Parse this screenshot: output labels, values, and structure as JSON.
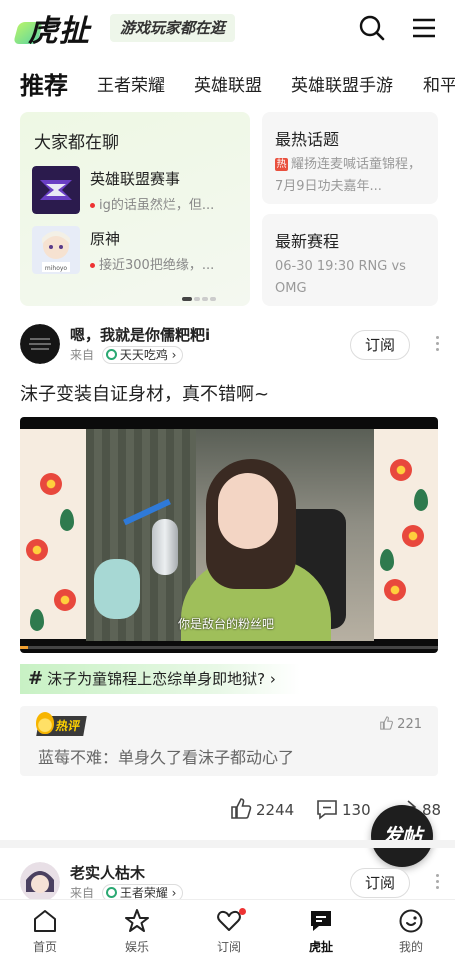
{
  "header": {
    "logo_text": "虎扯",
    "slogan": "游戏玩家都在逛",
    "search_icon": "search-icon",
    "menu_icon": "menu-icon"
  },
  "tabs": [
    {
      "label": "推荐",
      "active": true
    },
    {
      "label": "王者荣耀",
      "active": false
    },
    {
      "label": "英雄联盟",
      "active": false
    },
    {
      "label": "英雄联盟手游",
      "active": false
    },
    {
      "label": "和平",
      "active": false
    }
  ],
  "chat_card": {
    "title": "大家都在聊",
    "items": [
      {
        "name": "英雄联盟赛事",
        "snippet": "ig的话虽然烂，但..."
      },
      {
        "name": "原神",
        "snippet": "接近300把绝缘，..."
      }
    ],
    "pager": {
      "total": 4,
      "current": 1
    }
  },
  "hot_topic": {
    "title": "最热话题",
    "tag": "热",
    "body": "耀扬连麦喊话童锦程，7月9日功夫嘉年..."
  },
  "latest_match": {
    "title": "最新赛程",
    "body": "06-30 19:30 RNG vs OMG"
  },
  "post1": {
    "author": "嗯，我就是你儒粑粑i",
    "from_label": "来自",
    "circle": "天天吃鸡",
    "subscribe_label": "订阅",
    "text": "沫子变装自证身材，真不错啊~",
    "video_subtitle": "你是敌台的粉丝吧",
    "video_progress": 0.02,
    "topic": "沫子为童锦程上恋综单身即地狱?",
    "topic_mark": "#",
    "hot_comment": {
      "badge": "热评",
      "likes": "221",
      "text": "蓝莓不难：单身久了看沫子都动心了"
    },
    "actions": {
      "likes": "2244",
      "comments": "130",
      "shares": "88"
    }
  },
  "fab_label": "发帖",
  "post2": {
    "author": "老实人枯木",
    "from_label": "来自",
    "circle": "王者荣耀",
    "subscribe_label": "订阅"
  },
  "tabbar": [
    {
      "label": "首页",
      "icon": "home-icon",
      "active": false
    },
    {
      "label": "娱乐",
      "icon": "star-icon",
      "active": false
    },
    {
      "label": "订阅",
      "icon": "heart-icon",
      "active": false,
      "badge": true
    },
    {
      "label": "虎扯",
      "icon": "chat-icon",
      "active": true
    },
    {
      "label": "我的",
      "icon": "profile-icon",
      "active": false
    }
  ],
  "colors": {
    "accent_green": "#5fd6a0",
    "brand_red": "#e33333",
    "hot_yellow": "#ffd200"
  }
}
